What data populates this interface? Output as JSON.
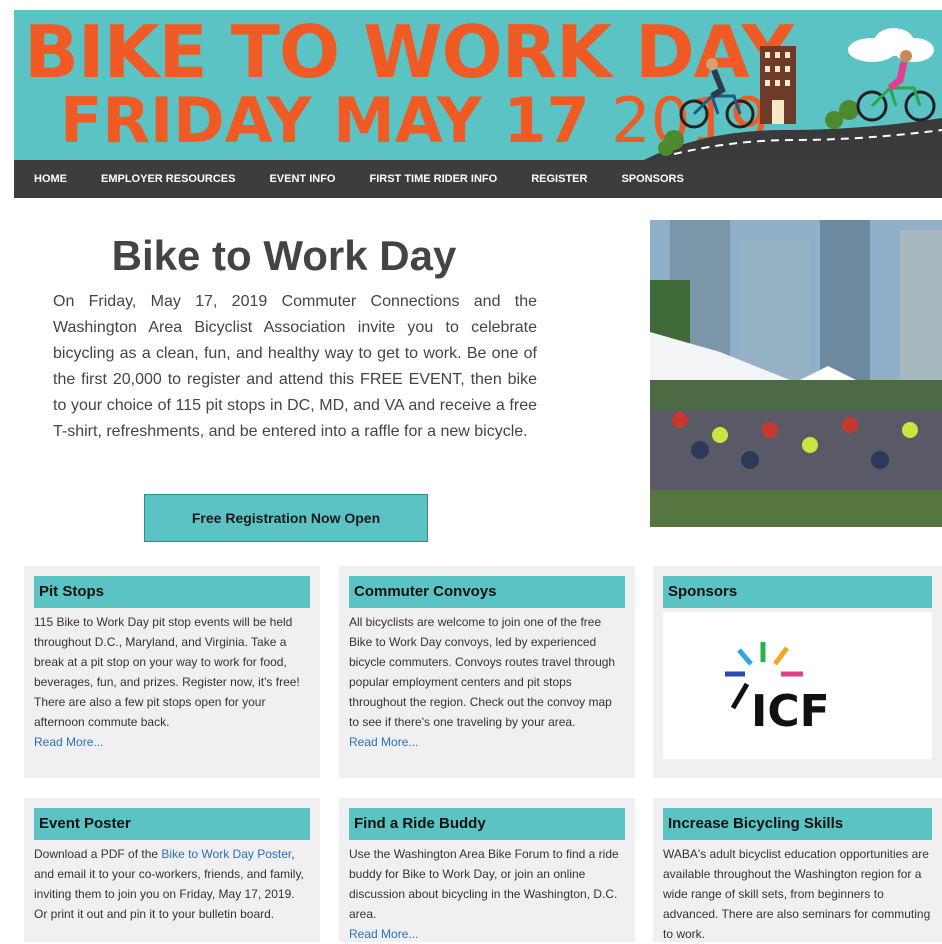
{
  "banner": {
    "line1": "BIKE TO WORK DAY",
    "line2_main": "FRIDAY MAY 17",
    "line2_year": "2019"
  },
  "nav": [
    "HOME",
    "EMPLOYER RESOURCES",
    "EVENT INFO",
    "FIRST TIME RIDER INFO",
    "REGISTER",
    "SPONSORS"
  ],
  "main": {
    "title": "Bike to Work Day",
    "intro": "On Friday, May 17, 2019 Commuter Connections and the Washington Area Bicyclist Association invite you to celebrate bicycling as a clean, fun, and healthy way to get to work. Be one of the first 20,000 to register and attend this FREE EVENT, then bike to your choice of 115 pit stops in DC, MD, and VA and receive a free T-shirt, refreshments, and be entered into a raffle for a new bicycle.",
    "register_button": "Free Registration Now Open"
  },
  "cards": {
    "pit_stops": {
      "title": "Pit Stops",
      "body": "115 Bike to Work Day pit stop events will be held throughout D.C., Maryland, and Virginia. Take a break at a pit stop on your way to work for food, beverages, fun, and prizes. Register now, it's free! There are also a few pit stops open for your afternoon commute back.",
      "link": "Read More..."
    },
    "convoys": {
      "title": "Commuter Convoys",
      "body": "All bicyclists are welcome to join one of the free Bike to Work Day convoys, led by experienced bicycle commuters. Convoys routes travel through popular employment centers and pit stops throughout the region. Check out the convoy map to see if there's one traveling by your area.",
      "link": "Read More..."
    },
    "sponsors": {
      "title": "Sponsors",
      "logo_text": "ICF"
    },
    "poster": {
      "title": "Event Poster",
      "body_pre": "Download a PDF of the ",
      "body_link": "Bike to Work Day Poster",
      "body_post": ", and email it to your co-workers, friends, and family, inviting them to join you on Friday, May 17, 2019. Or print it out and pin it to your bulletin board."
    },
    "buddy": {
      "title": "Find a Ride Buddy",
      "body": "Use the Washington Area Bike Forum to find a ride buddy for Bike to Work Day, or join an online discussion about bicycling in the Washington, D.C. area.",
      "link": "Read More..."
    },
    "skills": {
      "title": "Increase Bicycling Skills",
      "body": "WABA's adult bicyclist education opportunities are available throughout the Washington region for a wide range of skill sets, from beginners to advanced. There are also seminars for commuting to work."
    }
  },
  "colors": {
    "accent": "#5bc3c3",
    "banner_text": "#f05a24",
    "nav_bg": "#3d3d3d",
    "link": "#2a6fc0"
  }
}
